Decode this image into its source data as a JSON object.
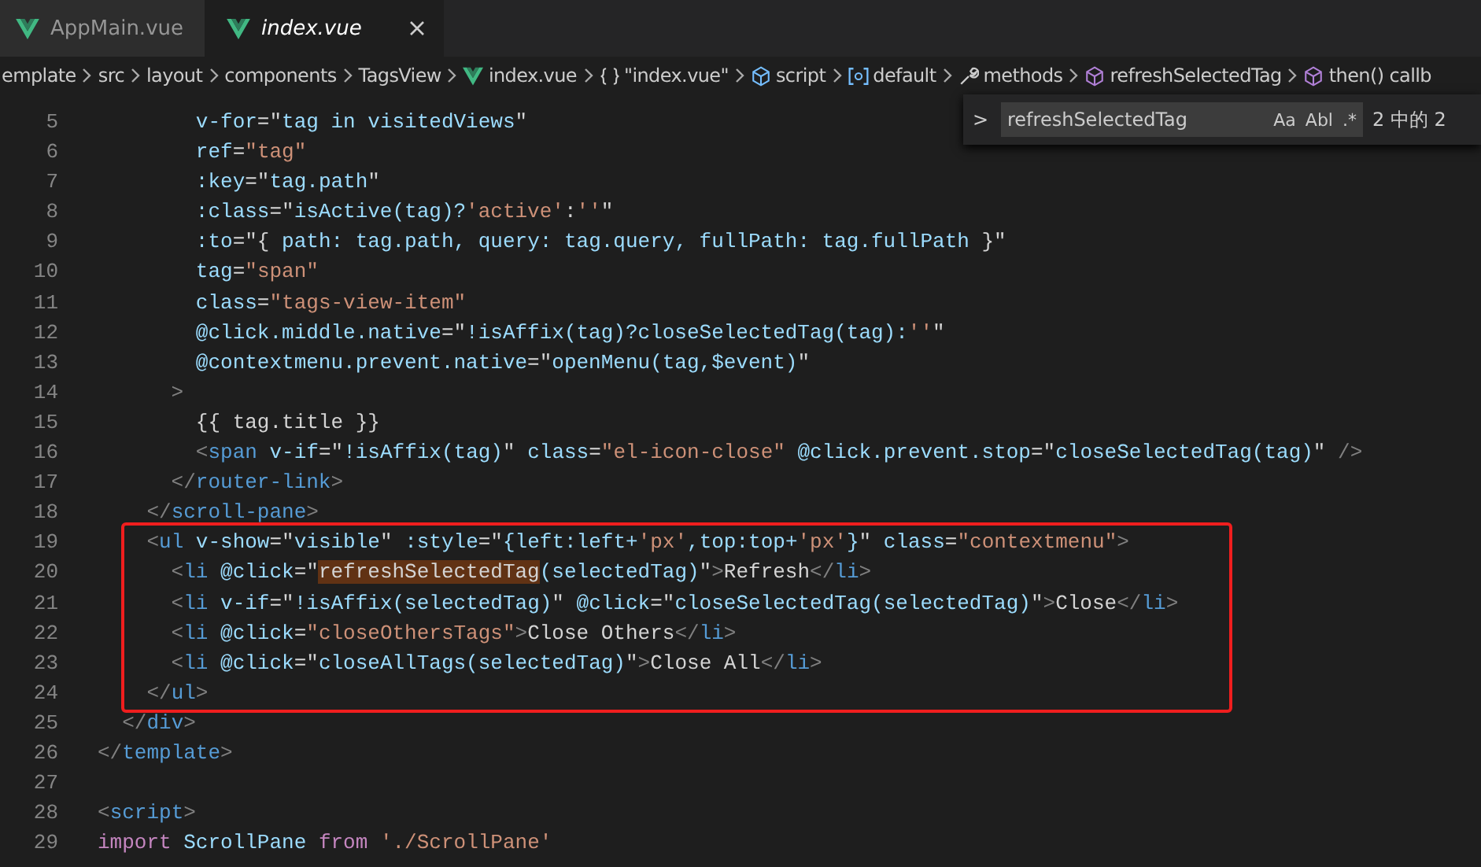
{
  "tabs": [
    {
      "label": "AppMain.vue",
      "selected": false
    },
    {
      "label": "index.vue",
      "selected": true
    }
  ],
  "breadcrumbs": [
    {
      "kind": "none",
      "label": "emplate"
    },
    {
      "kind": "none",
      "label": "src"
    },
    {
      "kind": "none",
      "label": "layout"
    },
    {
      "kind": "none",
      "label": "components"
    },
    {
      "kind": "none",
      "label": "TagsView"
    },
    {
      "kind": "vue",
      "label": "index.vue"
    },
    {
      "kind": "braces",
      "label": "\"index.vue\""
    },
    {
      "kind": "cube",
      "label": "script"
    },
    {
      "kind": "module",
      "label": "default"
    },
    {
      "kind": "wrench",
      "label": "methods"
    },
    {
      "kind": "method",
      "label": "refreshSelectedTag"
    },
    {
      "kind": "method",
      "label": "then() callb"
    }
  ],
  "find_widget": {
    "toggle": ">",
    "value": "refreshSelectedTag",
    "options": [
      "Aa",
      "Abl",
      ".*"
    ],
    "result": "2 中的 2"
  },
  "lines": [
    {
      "number": "5",
      "boxed": false,
      "tokens": [
        {
          "kind": "attr",
          "text": "        v-for"
        },
        {
          "kind": "op",
          "text": "=\""
        },
        {
          "kind": "js",
          "text": "tag in visitedViews"
        },
        {
          "kind": "op",
          "text": "\""
        }
      ]
    },
    {
      "number": "6",
      "boxed": false,
      "tokens": [
        {
          "kind": "attr",
          "text": "        ref"
        },
        {
          "kind": "op",
          "text": "="
        },
        {
          "kind": "str",
          "text": "\"tag\""
        }
      ]
    },
    {
      "number": "7",
      "boxed": false,
      "tokens": [
        {
          "kind": "attr",
          "text": "        :key"
        },
        {
          "kind": "op",
          "text": "=\""
        },
        {
          "kind": "js",
          "text": "tag.path"
        },
        {
          "kind": "op",
          "text": "\""
        }
      ]
    },
    {
      "number": "8",
      "boxed": false,
      "tokens": [
        {
          "kind": "attr",
          "text": "        :class"
        },
        {
          "kind": "op",
          "text": "=\""
        },
        {
          "kind": "js",
          "text": "isActive(tag)?"
        },
        {
          "kind": "str",
          "text": "'active'"
        },
        {
          "kind": "op",
          "text": ":"
        },
        {
          "kind": "str",
          "text": "''"
        },
        {
          "kind": "op",
          "text": "\""
        }
      ]
    },
    {
      "number": "9",
      "boxed": false,
      "tokens": [
        {
          "kind": "attr",
          "text": "        :to"
        },
        {
          "kind": "op",
          "text": "=\"{ "
        },
        {
          "kind": "js",
          "text": "path: tag.path, query: tag.query, fullPath: tag.fullPath"
        },
        {
          "kind": "op",
          "text": " }\""
        }
      ]
    },
    {
      "number": "10",
      "boxed": false,
      "tokens": [
        {
          "kind": "attr",
          "text": "        tag"
        },
        {
          "kind": "op",
          "text": "="
        },
        {
          "kind": "str",
          "text": "\"span\""
        }
      ]
    },
    {
      "number": "11",
      "boxed": false,
      "tokens": [
        {
          "kind": "attr",
          "text": "        class"
        },
        {
          "kind": "op",
          "text": "="
        },
        {
          "kind": "str",
          "text": "\"tags-view-item\""
        }
      ]
    },
    {
      "number": "12",
      "boxed": false,
      "tokens": [
        {
          "kind": "attr",
          "text": "        @click.middle.native"
        },
        {
          "kind": "op",
          "text": "=\""
        },
        {
          "kind": "js",
          "text": "!isAffix(tag)?closeSelectedTag(tag):"
        },
        {
          "kind": "str",
          "text": "''"
        },
        {
          "kind": "op",
          "text": "\""
        }
      ]
    },
    {
      "number": "13",
      "boxed": false,
      "tokens": [
        {
          "kind": "attr",
          "text": "        @contextmenu.prevent.native"
        },
        {
          "kind": "op",
          "text": "=\""
        },
        {
          "kind": "js",
          "text": "openMenu(tag,$event)"
        },
        {
          "kind": "op",
          "text": "\""
        }
      ]
    },
    {
      "number": "14",
      "boxed": false,
      "tokens": [
        {
          "kind": "punct",
          "text": "      >"
        }
      ]
    },
    {
      "number": "15",
      "boxed": false,
      "tokens": [
        {
          "kind": "text",
          "text": "        {{ tag.title }}"
        }
      ]
    },
    {
      "number": "16",
      "boxed": false,
      "tokens": [
        {
          "kind": "punct",
          "text": "        <"
        },
        {
          "kind": "tag",
          "text": "span"
        },
        {
          "kind": "attr",
          "text": " v-if"
        },
        {
          "kind": "op",
          "text": "=\""
        },
        {
          "kind": "js",
          "text": "!isAffix(tag)"
        },
        {
          "kind": "op",
          "text": "\" "
        },
        {
          "kind": "attr",
          "text": "class"
        },
        {
          "kind": "op",
          "text": "="
        },
        {
          "kind": "str",
          "text": "\"el-icon-close\""
        },
        {
          "kind": "attr",
          "text": " @click.prevent.stop"
        },
        {
          "kind": "op",
          "text": "=\""
        },
        {
          "kind": "js",
          "text": "closeSelectedTag(tag)"
        },
        {
          "kind": "op",
          "text": "\" "
        },
        {
          "kind": "punct",
          "text": "/>"
        }
      ]
    },
    {
      "number": "17",
      "boxed": false,
      "tokens": [
        {
          "kind": "punct",
          "text": "      </"
        },
        {
          "kind": "tag",
          "text": "router-link"
        },
        {
          "kind": "punct",
          "text": ">"
        }
      ]
    },
    {
      "number": "18",
      "boxed": false,
      "tokens": [
        {
          "kind": "punct",
          "text": "    </"
        },
        {
          "kind": "tag",
          "text": "scroll-pane"
        },
        {
          "kind": "punct",
          "text": ">"
        }
      ]
    },
    {
      "number": "19",
      "boxed": true,
      "tokens": [
        {
          "kind": "punct",
          "text": "    <"
        },
        {
          "kind": "tag",
          "text": "ul"
        },
        {
          "kind": "attr",
          "text": " v-show"
        },
        {
          "kind": "op",
          "text": "=\""
        },
        {
          "kind": "js",
          "text": "visible"
        },
        {
          "kind": "op",
          "text": "\" "
        },
        {
          "kind": "attr",
          "text": ":style"
        },
        {
          "kind": "op",
          "text": "=\""
        },
        {
          "kind": "js",
          "text": "{left:left+"
        },
        {
          "kind": "str",
          "text": "'px'"
        },
        {
          "kind": "js",
          "text": ",top:top+"
        },
        {
          "kind": "str",
          "text": "'px'"
        },
        {
          "kind": "js",
          "text": "}"
        },
        {
          "kind": "op",
          "text": "\" "
        },
        {
          "kind": "attr",
          "text": "class"
        },
        {
          "kind": "op",
          "text": "="
        },
        {
          "kind": "str",
          "text": "\"contextmenu\""
        },
        {
          "kind": "punct",
          "text": ">"
        }
      ]
    },
    {
      "number": "20",
      "boxed": true,
      "tokens": [
        {
          "kind": "punct",
          "text": "      <"
        },
        {
          "kind": "tag",
          "text": "li"
        },
        {
          "kind": "attr",
          "text": " @click"
        },
        {
          "kind": "op",
          "text": "=\""
        },
        {
          "kind": "match",
          "text": "refreshSelectedTag"
        },
        {
          "kind": "js",
          "text": "(selectedTag)"
        },
        {
          "kind": "op",
          "text": "\""
        },
        {
          "kind": "punct",
          "text": ">"
        },
        {
          "kind": "text",
          "text": "Refresh"
        },
        {
          "kind": "punct",
          "text": "</"
        },
        {
          "kind": "tag",
          "text": "li"
        },
        {
          "kind": "punct",
          "text": ">"
        }
      ]
    },
    {
      "number": "21",
      "boxed": true,
      "tokens": [
        {
          "kind": "punct",
          "text": "      <"
        },
        {
          "kind": "tag",
          "text": "li"
        },
        {
          "kind": "attr",
          "text": " v-if"
        },
        {
          "kind": "op",
          "text": "=\""
        },
        {
          "kind": "js",
          "text": "!isAffix(selectedTag)"
        },
        {
          "kind": "op",
          "text": "\" "
        },
        {
          "kind": "attr",
          "text": "@click"
        },
        {
          "kind": "op",
          "text": "=\""
        },
        {
          "kind": "js",
          "text": "closeSelectedTag(selectedTag)"
        },
        {
          "kind": "op",
          "text": "\""
        },
        {
          "kind": "punct",
          "text": ">"
        },
        {
          "kind": "text",
          "text": "Close"
        },
        {
          "kind": "punct",
          "text": "</"
        },
        {
          "kind": "tag",
          "text": "li"
        },
        {
          "kind": "punct",
          "text": ">"
        }
      ]
    },
    {
      "number": "22",
      "boxed": true,
      "tokens": [
        {
          "kind": "punct",
          "text": "      <"
        },
        {
          "kind": "tag",
          "text": "li"
        },
        {
          "kind": "attr",
          "text": " @click"
        },
        {
          "kind": "op",
          "text": "="
        },
        {
          "kind": "str",
          "text": "\"closeOthersTags\""
        },
        {
          "kind": "punct",
          "text": ">"
        },
        {
          "kind": "text",
          "text": "Close Others"
        },
        {
          "kind": "punct",
          "text": "</"
        },
        {
          "kind": "tag",
          "text": "li"
        },
        {
          "kind": "punct",
          "text": ">"
        }
      ]
    },
    {
      "number": "23",
      "boxed": true,
      "tokens": [
        {
          "kind": "punct",
          "text": "      <"
        },
        {
          "kind": "tag",
          "text": "li"
        },
        {
          "kind": "attr",
          "text": " @click"
        },
        {
          "kind": "op",
          "text": "=\""
        },
        {
          "kind": "js",
          "text": "closeAllTags(selectedTag)"
        },
        {
          "kind": "op",
          "text": "\""
        },
        {
          "kind": "punct",
          "text": ">"
        },
        {
          "kind": "text",
          "text": "Close All"
        },
        {
          "kind": "punct",
          "text": "</"
        },
        {
          "kind": "tag",
          "text": "li"
        },
        {
          "kind": "punct",
          "text": ">"
        }
      ]
    },
    {
      "number": "24",
      "boxed": true,
      "tokens": [
        {
          "kind": "punct",
          "text": "    </"
        },
        {
          "kind": "tag",
          "text": "ul"
        },
        {
          "kind": "punct",
          "text": ">"
        }
      ]
    },
    {
      "number": "25",
      "boxed": false,
      "tokens": [
        {
          "kind": "punct",
          "text": "  </"
        },
        {
          "kind": "tag",
          "text": "div"
        },
        {
          "kind": "punct",
          "text": ">"
        }
      ]
    },
    {
      "number": "26",
      "boxed": false,
      "tokens": [
        {
          "kind": "punct",
          "text": "</"
        },
        {
          "kind": "tag",
          "text": "template"
        },
        {
          "kind": "punct",
          "text": ">"
        }
      ]
    },
    {
      "number": "27",
      "boxed": false
    },
    {
      "number": "28",
      "boxed": false,
      "tokens": [
        {
          "kind": "punct",
          "text": "<"
        },
        {
          "kind": "tag",
          "text": "script"
        },
        {
          "kind": "punct",
          "text": ">"
        }
      ]
    },
    {
      "number": "29",
      "boxed": false,
      "tokens": [
        {
          "kind": "keyword",
          "text": "import"
        },
        {
          "kind": "js",
          "text": " ScrollPane "
        },
        {
          "kind": "keyword",
          "text": "from"
        },
        {
          "kind": "str",
          "text": " './ScrollPane'"
        }
      ]
    }
  ]
}
